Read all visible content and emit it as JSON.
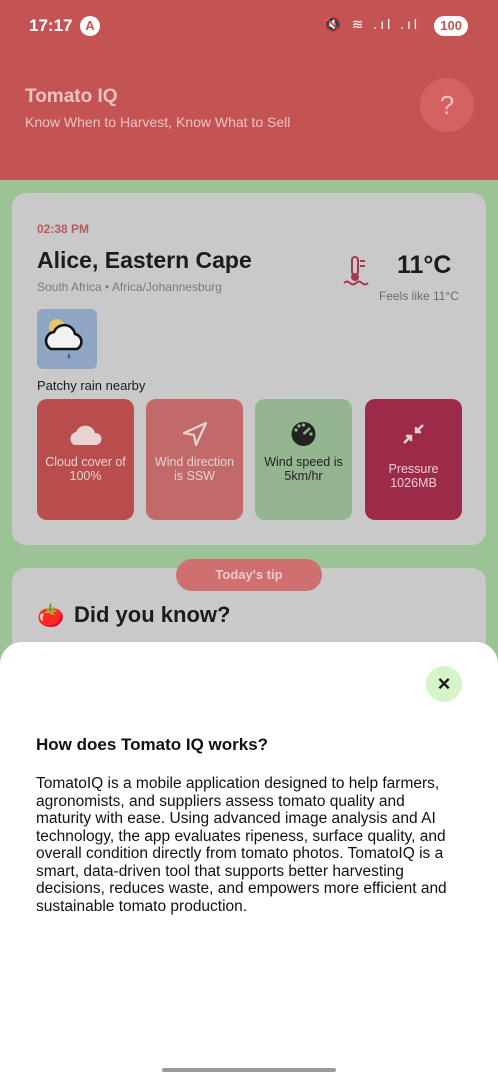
{
  "status_bar": {
    "time": "17:17",
    "indicator": "A",
    "icons": "🔇 ≋ .ıl .ıl",
    "battery": "100"
  },
  "header": {
    "title": "Tomato IQ",
    "subtitle": "Know When to Harvest, Know What to Sell",
    "help_label": "?"
  },
  "weather": {
    "time": "02:38 PM",
    "city": "Alice, Eastern Cape",
    "country": "South Africa • Africa/Johannesburg",
    "temperature": "11°C",
    "feels_like": "Feels like 11°C",
    "condition": "Patchy rain nearby",
    "tiles": [
      {
        "label": "Cloud cover of 100%",
        "icon": "cloud-icon"
      },
      {
        "label": "Wind direction is SSW",
        "icon": "navigation-arrow-icon"
      },
      {
        "label": "Wind speed is 5km/hr",
        "icon": "speedometer-icon"
      },
      {
        "label": "Pressure 1026MB",
        "icon": "compress-arrows-icon"
      }
    ]
  },
  "tip": {
    "pill": "Today's tip",
    "icon": "🍅",
    "title": "Did you know?"
  },
  "sheet": {
    "close_label": "×",
    "title": "How does Tomato IQ works?",
    "body": "TomatoIQ is a mobile application designed to help farmers, agronomists, and suppliers assess tomato quality and maturity with ease. Using advanced image analysis and AI technology, the app evaluates ripeness, surface quality, and overall condition directly from tomato photos. TomatoIQ is a smart, data-driven tool that supports better harvesting decisions, reduces waste, and empowers more efficient and sustainable tomato production."
  }
}
